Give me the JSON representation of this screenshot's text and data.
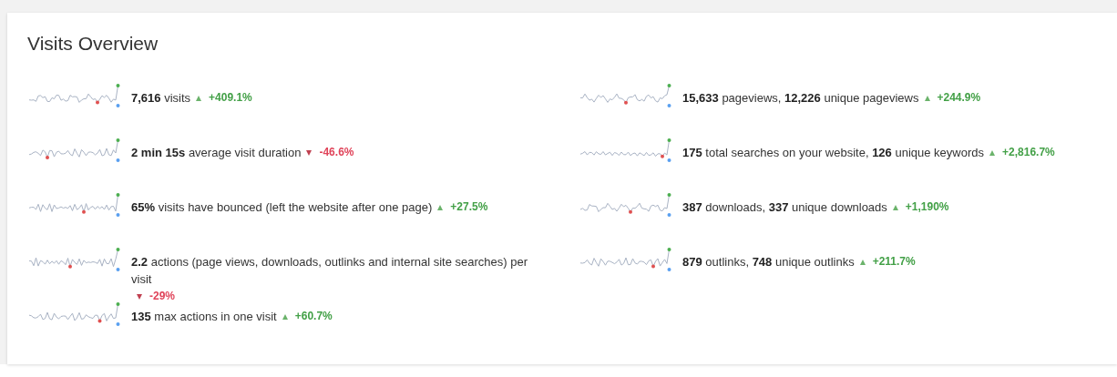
{
  "title": "Visits Overview",
  "columns": [
    [
      {
        "text": "**7,616** visits",
        "kind": "increase",
        "change": "+409.1%"
      },
      {
        "text": "**2 min 15s** average visit duration",
        "kind": "decrease",
        "change": "-46.6%"
      },
      {
        "text": "**65%** visits have bounced (left the website after one page)",
        "kind": "increase",
        "change": "+27.5%"
      },
      {
        "text": "**2.2** actions (page views, downloads, outlinks and internal site searches) per visit",
        "kind": "decrease",
        "change": "-29%"
      },
      {
        "text": "**135** max actions in one visit",
        "kind": "increase",
        "change": "+60.7%"
      }
    ],
    [
      {
        "text": "**15,633** pageviews, **12,226** unique pageviews",
        "kind": "increase",
        "change": "+244.9%"
      },
      {
        "text": "**175** total searches on your website, **126** unique keywords",
        "kind": "increase",
        "change": "+2,816.7%"
      },
      {
        "text": "**387** downloads, **337** unique downloads",
        "kind": "increase",
        "change": "+1,190%"
      },
      {
        "text": "**879** outlinks, **748** unique outlinks",
        "kind": "increase",
        "change": "+211.7%"
      }
    ]
  ]
}
